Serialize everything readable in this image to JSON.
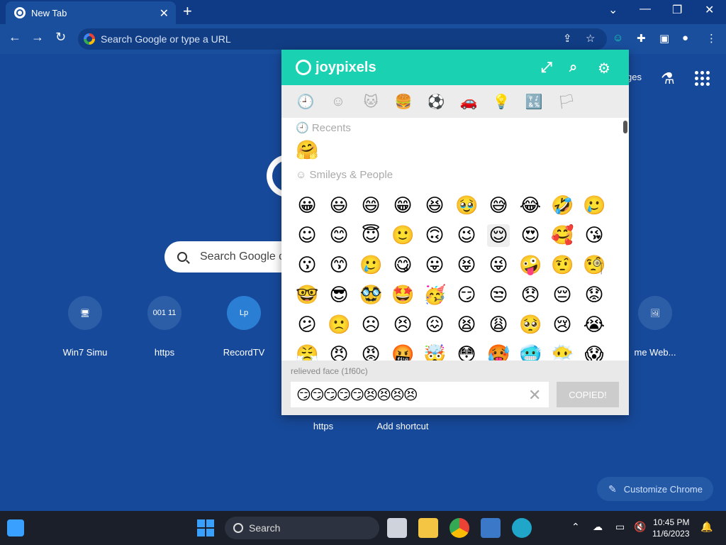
{
  "browser": {
    "tab_title": "New Tab",
    "tab_close": "✕",
    "newtab": "+",
    "omnibox_placeholder": "Search Google or type a URL",
    "window_controls": [
      "⌄",
      "—",
      "❐",
      "✕"
    ]
  },
  "ntp": {
    "search_placeholder": "Search Google c",
    "right_text": "ges",
    "shortcuts": [
      {
        "label": "Win7 Simu",
        "icon": "🖥"
      },
      {
        "label": "https",
        "icon": "001 11"
      },
      {
        "label": "RecordTV",
        "icon": "Lp"
      },
      {
        "label": "me Web...",
        "icon": "🖼"
      }
    ],
    "bottom_shortcuts": [
      "https",
      "Add shortcut"
    ],
    "customize_label": "Customize Chrome"
  },
  "popup": {
    "brand": "joypixels",
    "categories": [
      "🕘",
      "☺",
      "🐱",
      "🍔",
      "⚽",
      "🚗",
      "💡",
      "🔣",
      "🏳"
    ],
    "sections": [
      {
        "title": "🕘 Recents",
        "emojis": [
          "🤗"
        ]
      },
      {
        "title": "☺ Smileys & People",
        "emojis": [
          "😀",
          "😃",
          "😄",
          "😁",
          "😆",
          "🥹",
          "😅",
          "😂",
          "🤣",
          "🥲",
          "☺",
          "😊",
          "😇",
          "🙂",
          "🙃",
          "😉",
          "😌",
          "😍",
          "🥰",
          "😘",
          "😗",
          "😙",
          "🥲",
          "😋",
          "😛",
          "😝",
          "😜",
          "🤪",
          "🤨",
          "🧐",
          "🤓",
          "😎",
          "🥸",
          "🤩",
          "🥳",
          "😏",
          "😒",
          "😞",
          "😔",
          "😟",
          "😕",
          "🙁",
          "☹",
          "😣",
          "😖",
          "😫",
          "😩",
          "🥺",
          "😢",
          "😭",
          "😤",
          "😠",
          "😡",
          "🤬",
          "🤯",
          "😳",
          "🥵",
          "🥶",
          "😶‍🌫️",
          "😱"
        ]
      }
    ],
    "selected_name": "relieved face (1f60c)",
    "copy_value": "😏😏😏😏😏😣😣😣😣",
    "clear_label": "✕",
    "copied_label": "COPIED!"
  },
  "taskbar": {
    "search_label": "Search",
    "time": "10:45 PM",
    "date": "11/6/2023"
  }
}
